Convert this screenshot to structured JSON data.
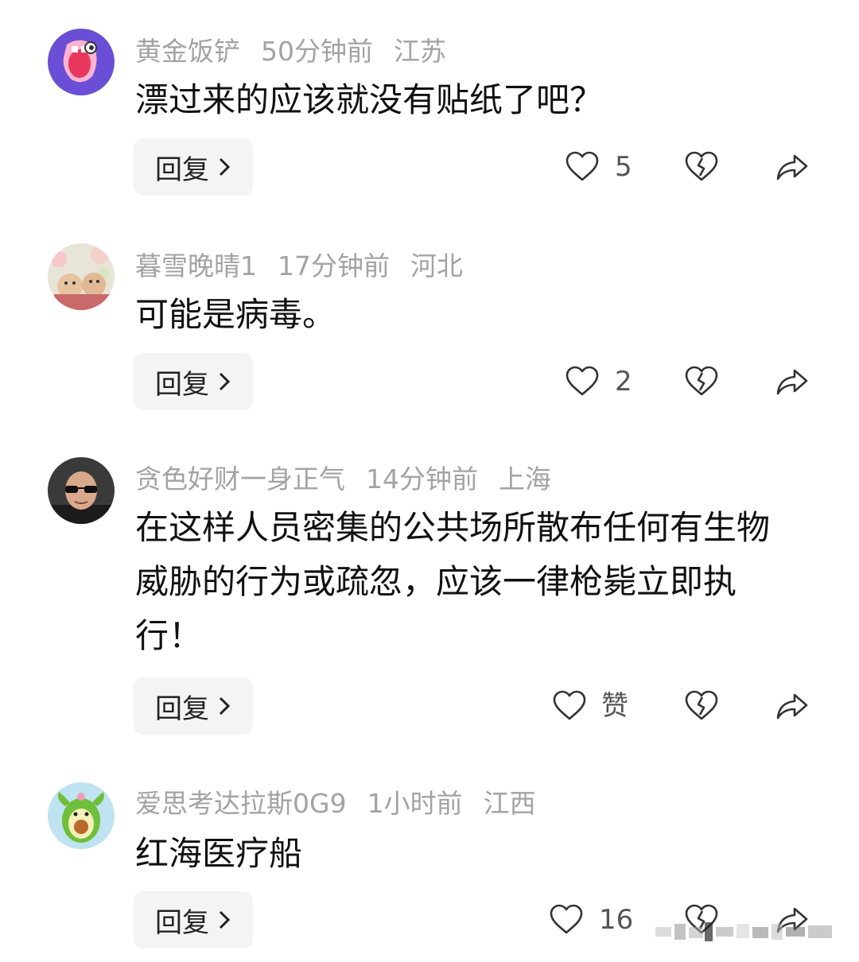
{
  "comments": [
    {
      "user": "黄金饭铲",
      "time": "50分钟前",
      "location": "江苏",
      "text": "漂过来的应该就没有贴纸了吧？",
      "reply_label": "回复",
      "likes": "5"
    },
    {
      "user": "暮雪晚晴1",
      "time": "17分钟前",
      "location": "河北",
      "text": "可能是病毒。",
      "reply_label": "回复",
      "likes": "2"
    },
    {
      "user": "贪色好财一身正气",
      "time": "14分钟前",
      "location": "上海",
      "text": "在这样人员密集的公共场所散布任何有生物威胁的行为或疏忽，应该一律枪毙立即执行！",
      "reply_label": "回复",
      "likes": "赞"
    },
    {
      "user": "爱思考达拉斯0G9",
      "time": "1小时前",
      "location": "江西",
      "text": "红海医疗船",
      "reply_label": "回复",
      "likes": "16"
    }
  ],
  "icons": {
    "like": "heart-outline-icon",
    "dislike": "broken-heart-icon",
    "share": "share-arrow-icon",
    "reply_chevron": "chevron-right-icon"
  },
  "colors": {
    "meta_text": "#a3a3a3",
    "body_text": "#111111",
    "reply_bg": "#f4f4f4",
    "icon_stroke": "#333333"
  }
}
